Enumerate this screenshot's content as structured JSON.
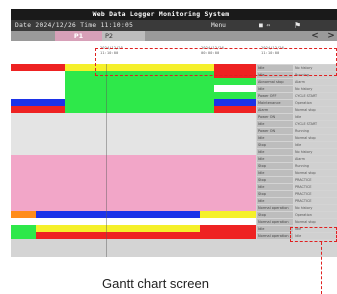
{
  "window": {
    "title": "Web Data Logger Monitoring System",
    "datetime": "Date 2024/12/26 Time 11:10:05",
    "menu_label": "Menu",
    "download_label": "■ ⇔",
    "settings_icon": "tool-icon"
  },
  "tabs": [
    {
      "label": "P1",
      "active": true
    },
    {
      "label": "P2",
      "active": false
    }
  ],
  "nav": {
    "prev": "<",
    "next": ">"
  },
  "timeline": {
    "ticks": [
      "2024/12/25\n11:10:00",
      "2024/12/26\n00:00:00",
      "2024/12/26\n11:10:00"
    ]
  },
  "colors": {
    "red": "#ee2222",
    "yellow": "#f5f02a",
    "green": "#2ee84a",
    "blue": "#1c32e8",
    "gray": "#e4e4e4",
    "pink": "#f2a6c8",
    "orange": "#ff8c1a",
    "white": "#ffffff"
  },
  "rows": [
    {
      "label": "Idle",
      "info": "No history",
      "segments": [
        [
          "red",
          0,
          0.22
        ],
        [
          "yellow",
          0.22,
          0.83
        ],
        [
          "red",
          0.83,
          1
        ]
      ]
    },
    {
      "label": "Idle",
      "info": "Running",
      "segments": [
        [
          "white",
          0,
          0.22
        ],
        [
          "green",
          0.22,
          0.83
        ],
        [
          "red",
          0.83,
          1
        ]
      ]
    },
    {
      "label": "Abnormal stop",
      "info": "Alarm",
      "segments": [
        [
          "white",
          0,
          0.22
        ],
        [
          "green",
          0.22,
          1
        ]
      ]
    },
    {
      "label": "Idle",
      "info": "No history",
      "segments": [
        [
          "white",
          0,
          0.22
        ],
        [
          "green",
          0.22,
          0.83
        ],
        [
          "white",
          0.83,
          1
        ]
      ]
    },
    {
      "label": "Power OFF",
      "info": "CYCLE START",
      "segments": [
        [
          "white",
          0,
          0.22
        ],
        [
          "green",
          0.22,
          1
        ]
      ]
    },
    {
      "label": "Maintenance",
      "info": "Operation",
      "segments": [
        [
          "blue",
          0,
          0.22
        ],
        [
          "green",
          0.22,
          0.83
        ],
        [
          "blue",
          0.83,
          1
        ]
      ]
    },
    {
      "label": "Alarm",
      "info": "Normal stop",
      "segments": [
        [
          "red",
          0,
          0.22
        ],
        [
          "green",
          0.22,
          0.83
        ],
        [
          "red",
          0.83,
          1
        ]
      ]
    },
    {
      "label": "Power ON",
      "info": "Idle",
      "segments": [
        [
          "gray",
          0,
          1
        ]
      ]
    },
    {
      "label": "Idle",
      "info": "CYCLE START",
      "segments": [
        [
          "gray",
          0,
          1
        ]
      ]
    },
    {
      "label": "Power ON",
      "info": "Running",
      "segments": [
        [
          "gray",
          0,
          1
        ]
      ]
    },
    {
      "label": "Idle",
      "info": "Normal stop",
      "segments": [
        [
          "gray",
          0,
          1
        ]
      ]
    },
    {
      "label": "Stop",
      "info": "Idle",
      "segments": [
        [
          "gray",
          0,
          1
        ]
      ]
    },
    {
      "label": "Idle",
      "info": "No history",
      "segments": [
        [
          "gray",
          0,
          1
        ]
      ]
    },
    {
      "label": "Idle",
      "info": "Alarm",
      "segments": [
        [
          "pink",
          0,
          1
        ]
      ]
    },
    {
      "label": "Stop",
      "info": "Running",
      "segments": [
        [
          "pink",
          0,
          1
        ]
      ]
    },
    {
      "label": "Idle",
      "info": "Normal stop",
      "segments": [
        [
          "pink",
          0,
          1
        ]
      ]
    },
    {
      "label": "Stop",
      "info": "PRACTICE",
      "segments": [
        [
          "pink",
          0,
          1
        ]
      ]
    },
    {
      "label": "Idle",
      "info": "PRACTICE",
      "segments": [
        [
          "pink",
          0,
          1
        ]
      ]
    },
    {
      "label": "Stop",
      "info": "PRACTICE",
      "segments": [
        [
          "pink",
          0,
          1
        ]
      ]
    },
    {
      "label": "Idle",
      "info": "PRACTICE",
      "segments": [
        [
          "pink",
          0,
          1
        ]
      ]
    },
    {
      "label": "Normal operation",
      "info": "No history",
      "segments": [
        [
          "pink",
          0,
          1
        ]
      ]
    },
    {
      "label": "Stop",
      "info": "Operation",
      "segments": [
        [
          "orange",
          0,
          0.1
        ],
        [
          "blue",
          0.1,
          0.77
        ],
        [
          "yellow",
          0.77,
          1
        ]
      ]
    },
    {
      "label": "Normal operation",
      "info": "Normal stop",
      "segments": [
        [
          "white",
          0,
          1
        ]
      ]
    },
    {
      "label": "Idle",
      "info": "Idle",
      "segments": [
        [
          "green",
          0,
          0.1
        ],
        [
          "yellow",
          0.1,
          0.77
        ],
        [
          "red",
          0.77,
          1
        ]
      ]
    },
    {
      "label": "Normal operation",
      "info": "Idle",
      "segments": [
        [
          "green",
          0,
          0.1
        ],
        [
          "red",
          0.1,
          1
        ]
      ]
    }
  ],
  "caption": "Gantt chart screen"
}
